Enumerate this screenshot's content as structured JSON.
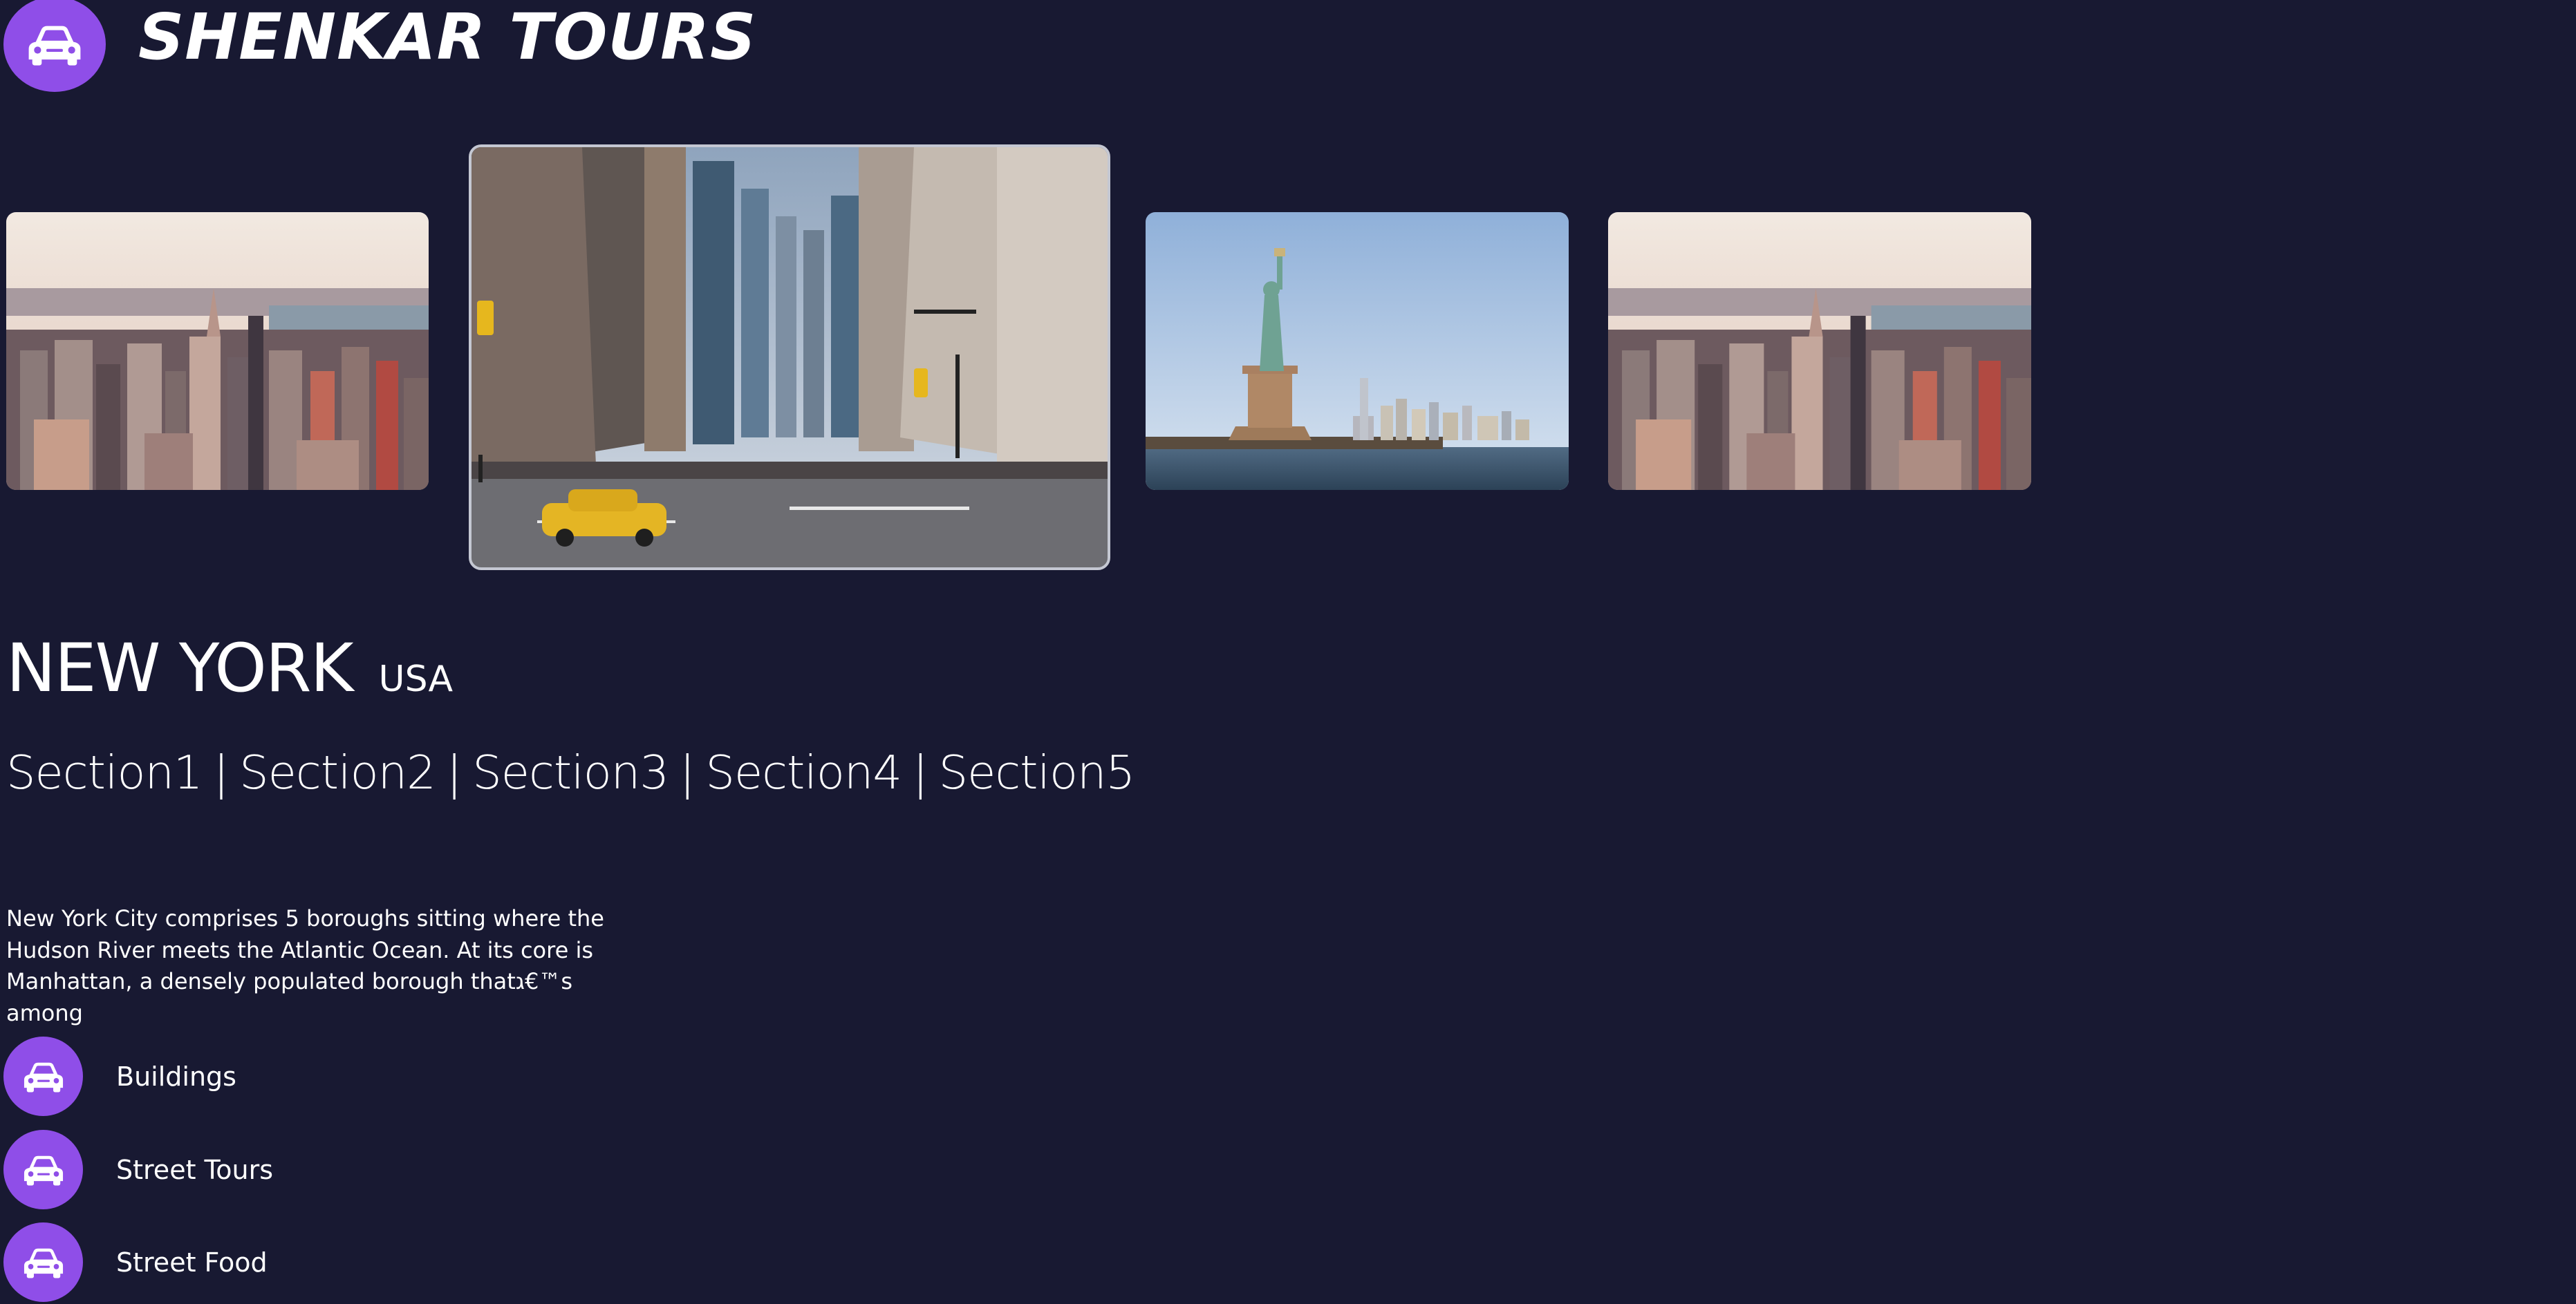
{
  "colors": {
    "background": "#181932",
    "accent": "#8f4ee8",
    "text": "#ffffff",
    "active_slide_border": "#c4c7d2"
  },
  "header": {
    "logo_icon": "car-icon",
    "brand": "SHENKAR TOURS"
  },
  "carousel": {
    "slides": [
      {
        "image": "city-skyline-aerial",
        "active": false
      },
      {
        "image": "street-with-yellow-taxi",
        "active": true
      },
      {
        "image": "statue-of-liberty",
        "active": false
      },
      {
        "image": "city-skyline-aerial",
        "active": false
      }
    ]
  },
  "destination": {
    "city": "NEW YORK",
    "country": "USA"
  },
  "sections": [
    "Section1",
    "Section2",
    "Section3",
    "Section4",
    "Section5"
  ],
  "separator": "|",
  "description": "New York City comprises 5 boroughs sitting where the Hudson River meets the Atlantic Ocean. At its core is Manhattan, a densely populated borough thatג€™s among",
  "features": [
    {
      "icon": "car-icon",
      "label": "Buildings"
    },
    {
      "icon": "car-icon",
      "label": "Street Tours"
    },
    {
      "icon": "car-icon",
      "label": "Street Food"
    }
  ]
}
